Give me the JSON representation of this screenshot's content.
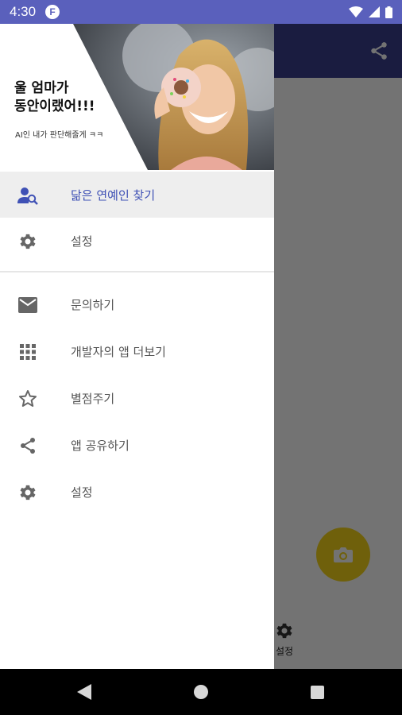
{
  "status_bar": {
    "time": "4:30",
    "app_badge": "F"
  },
  "drawer": {
    "header": {
      "title": "울 엄마가\n동안이랬어!!!",
      "subtitle": "AI인 내가 판단해줄게 ㅋㅋ"
    },
    "primary_items": [
      {
        "label": "닮은 연예인 찾기",
        "icon": "person-search-icon",
        "active": true
      },
      {
        "label": "설정",
        "icon": "gear-icon",
        "active": false
      }
    ],
    "secondary_items": [
      {
        "label": "문의하기",
        "icon": "mail-icon"
      },
      {
        "label": "개발자의 앱 더보기",
        "icon": "apps-grid-icon"
      },
      {
        "label": "별점주기",
        "icon": "star-icon"
      },
      {
        "label": "앱 공유하기",
        "icon": "share-icon"
      },
      {
        "label": "설정",
        "icon": "gear-icon"
      }
    ]
  },
  "background_app": {
    "bottom_settings_label": "설정"
  },
  "colors": {
    "status_bar": "#5a60bc",
    "toolbar": "#3a3f8f",
    "accent": "#3f51b5",
    "fab": "#f5d61a"
  }
}
